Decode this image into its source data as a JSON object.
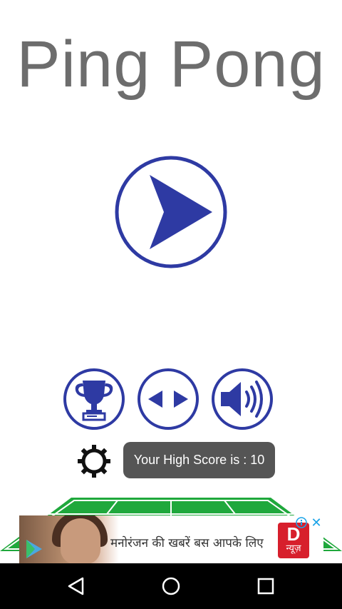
{
  "app": {
    "title": "Ping Pong"
  },
  "menu": {
    "play_icon": "play-icon",
    "buttons": [
      {
        "name": "leaderboard-button",
        "icon": "trophy-icon"
      },
      {
        "name": "more-games-button",
        "icon": "left-right-arrows-icon"
      },
      {
        "name": "sound-toggle-button",
        "icon": "speaker-icon"
      }
    ],
    "settings_icon": "gear-icon"
  },
  "toast": {
    "text": "Your High Score is : 10"
  },
  "ad": {
    "text": "मनोरंजन की खबरें बस आपके लिए",
    "logo_big": "D",
    "logo_small": "न्यूज़",
    "close_label": "✕"
  },
  "colors": {
    "accent": "#2e3aa3",
    "title_gray": "#6d6d6d",
    "court_green": "#1fa83c",
    "toast_bg": "#555555",
    "navbar_bg": "#000000"
  },
  "navbar": {
    "back_icon": "back-triangle-icon",
    "home_icon": "home-circle-icon",
    "recents_icon": "recents-square-icon"
  }
}
